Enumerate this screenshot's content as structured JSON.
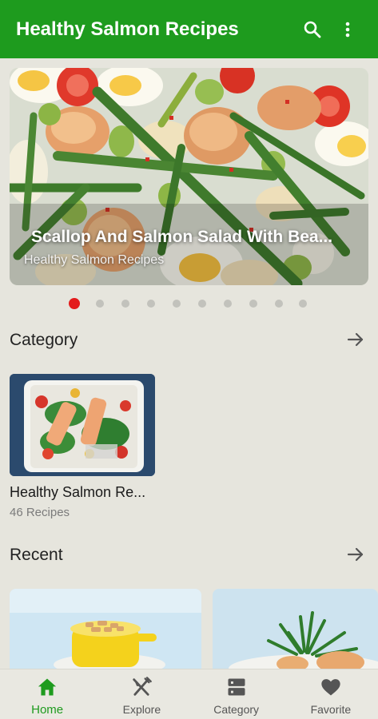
{
  "app_bar": {
    "title": "Healthy Salmon Recipes",
    "search_icon": "search-icon",
    "more_icon": "more-vertical-icon"
  },
  "slider": {
    "title": "Scallop And Salmon Salad With Bea...",
    "subtitle": "Healthy Salmon Recipes",
    "dot_count": 10,
    "active_index": 0
  },
  "category_section": {
    "title": "Category",
    "arrow_icon": "arrow-right-icon",
    "items": [
      {
        "name": "Healthy Salmon Re...",
        "count": "46 Recipes"
      }
    ]
  },
  "recent_section": {
    "title": "Recent",
    "arrow_icon": "arrow-right-icon"
  },
  "bottom_nav": {
    "items": [
      {
        "label": "Home",
        "icon": "home-icon",
        "active": true
      },
      {
        "label": "Explore",
        "icon": "utensils-icon",
        "active": false
      },
      {
        "label": "Category",
        "icon": "server-icon",
        "active": false
      },
      {
        "label": "Favorite",
        "icon": "heart-icon",
        "active": false
      }
    ]
  },
  "colors": {
    "primary": "#1e9b1e",
    "background": "#e6e5dd",
    "dot_active": "#e31b1b",
    "dot_inactive": "#c2c2bc"
  }
}
